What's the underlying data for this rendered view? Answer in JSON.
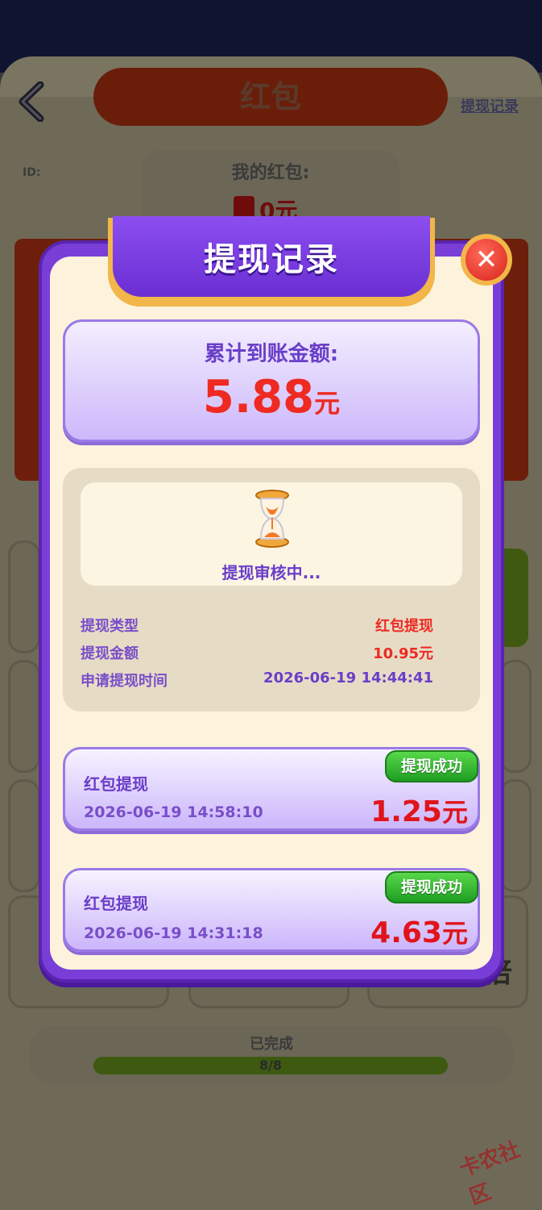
{
  "background": {
    "title": "红包",
    "record_link": "提现记录",
    "id_label": "ID:",
    "my_redpacket_label": "我的红包:",
    "my_redpacket_amount": "0元",
    "multiplier_text": "倍",
    "progress_label": "已完成",
    "progress_value": "8/8",
    "progress_fraction": 1.0,
    "watermark": "卡农社区"
  },
  "modal": {
    "title": "提现记录",
    "close_icon": "close-icon",
    "total": {
      "label": "累计到账金额:",
      "amount": "5.88",
      "unit": "元"
    },
    "pending": {
      "icon": "hourglass-icon",
      "status_text": "提现审核中...",
      "rows": [
        {
          "key": "提现类型",
          "value": "红包提现"
        },
        {
          "key": "提现金额",
          "value": "10.95元"
        },
        {
          "key": "申请提现时间",
          "value": "2026-06-19 14:44:41"
        }
      ]
    },
    "records": [
      {
        "type": "红包提现",
        "time": "2026-06-19 14:58:10",
        "amount": "1.25",
        "unit": "元",
        "status": "提现成功"
      },
      {
        "type": "红包提现",
        "time": "2026-06-19 14:31:18",
        "amount": "4.63",
        "unit": "元",
        "status": "提现成功"
      }
    ]
  },
  "colors": {
    "accent_purple": "#7a3ed8",
    "amount_red": "#ee2a22",
    "success_green": "#2fb52a",
    "modal_bg": "#fdf3dc"
  }
}
